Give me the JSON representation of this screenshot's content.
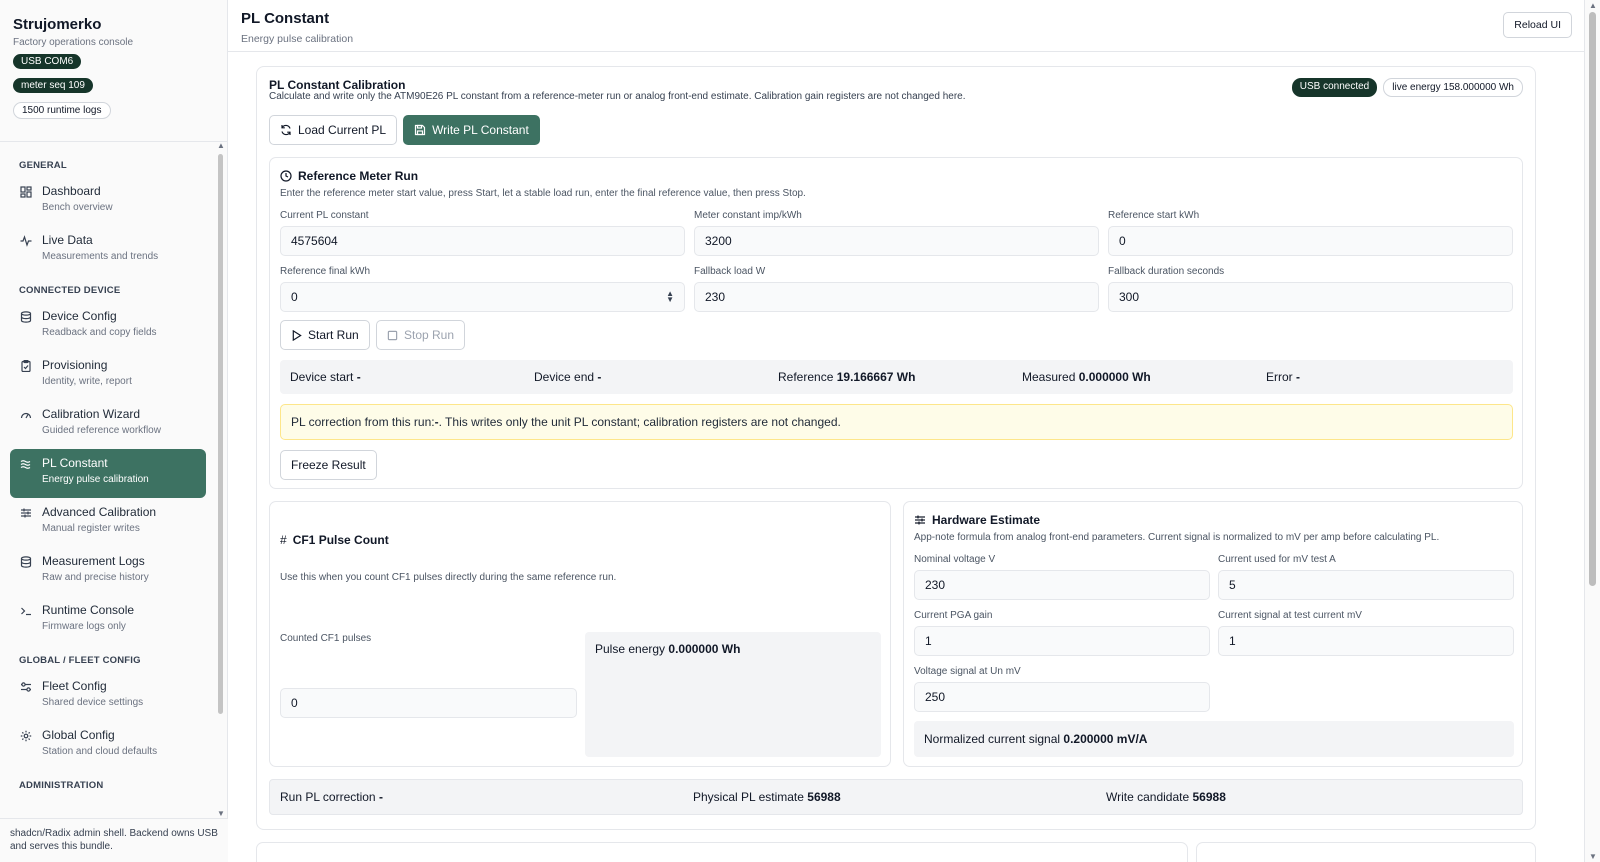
{
  "app": {
    "name": "Strujomerko",
    "subtitle": "Factory operations console",
    "pills": [
      "USB COM6",
      "meter seq 109",
      "1500 runtime logs"
    ],
    "footer": "shadcn/Radix admin shell. Backend owns USB and serves this bundle."
  },
  "sidebar": {
    "sections": [
      {
        "title": "GENERAL",
        "items": [
          {
            "label": "Dashboard",
            "sub": "Bench overview",
            "icon": "dashboard-icon"
          },
          {
            "label": "Live Data",
            "sub": "Measurements and trends",
            "icon": "activity-icon"
          }
        ]
      },
      {
        "title": "CONNECTED DEVICE",
        "items": [
          {
            "label": "Device Config",
            "sub": "Readback and copy fields",
            "icon": "database-icon"
          },
          {
            "label": "Provisioning",
            "sub": "Identity, write, report",
            "icon": "clipboard-icon"
          },
          {
            "label": "Calibration Wizard",
            "sub": "Guided reference workflow",
            "icon": "gauge-icon"
          },
          {
            "label": "PL Constant",
            "sub": "Energy pulse calibration",
            "icon": "waves-icon",
            "active": true
          },
          {
            "label": "Advanced Calibration",
            "sub": "Manual register writes",
            "icon": "sliders-icon"
          },
          {
            "label": "Measurement Logs",
            "sub": "Raw and precise history",
            "icon": "database-icon"
          },
          {
            "label": "Runtime Console",
            "sub": "Firmware logs only",
            "icon": "terminal-icon"
          }
        ]
      },
      {
        "title": "GLOBAL / FLEET CONFIG",
        "items": [
          {
            "label": "Fleet Config",
            "sub": "Shared device settings",
            "icon": "settings2-icon"
          },
          {
            "label": "Global Config",
            "sub": "Station and cloud defaults",
            "icon": "gear-icon"
          }
        ]
      },
      {
        "title": "ADMINISTRATION",
        "items": []
      }
    ]
  },
  "header": {
    "title": "PL Constant",
    "subtitle": "Energy pulse calibration",
    "reload_label": "Reload UI"
  },
  "calibration": {
    "title": "PL Constant Calibration",
    "description": "Calculate and write only the ATM90E26 PL constant from a reference-meter run or analog front-end estimate. Calibration gain registers are not changed here.",
    "status_usb": "USB connected",
    "status_energy": "live energy 158.000000 Wh",
    "load_label": "Load Current PL",
    "write_label": "Write PL Constant"
  },
  "reference_run": {
    "title": "Reference Meter Run",
    "description": "Enter the reference meter start value, press Start, let a stable load run, enter the final reference value, then press Stop.",
    "fields": {
      "current_pl": {
        "label": "Current PL constant",
        "value": "4575604"
      },
      "meter_constant": {
        "label": "Meter constant imp/kWh",
        "value": "3200"
      },
      "ref_start": {
        "label": "Reference start kWh",
        "value": "0"
      },
      "ref_final": {
        "label": "Reference final kWh",
        "value": "0"
      },
      "fallback_load": {
        "label": "Fallback load W",
        "value": "230"
      },
      "fallback_duration": {
        "label": "Fallback duration seconds",
        "value": "300"
      }
    },
    "start_label": "Start Run",
    "stop_label": "Stop Run",
    "summary": {
      "device_start_label": "Device start",
      "device_start": "-",
      "device_end_label": "Device end",
      "device_end": "-",
      "reference_label": "Reference",
      "reference": "19.166667 Wh",
      "measured_label": "Measured",
      "measured": "0.000000 Wh",
      "error_label": "Error",
      "error": "-"
    },
    "notice_prefix": "PL correction from this run: ",
    "notice_value": "-",
    "notice_suffix": ". This writes only the unit PL constant; calibration registers are not changed.",
    "freeze_label": "Freeze Result"
  },
  "cf1": {
    "title": "CF1 Pulse Count",
    "description": "Use this when you count CF1 pulses directly during the same reference run.",
    "counted_label": "Counted CF1 pulses",
    "counted_value": "0",
    "pulse_energy_label": "Pulse energy",
    "pulse_energy_value": "0.000000 Wh"
  },
  "hardware": {
    "title": "Hardware Estimate",
    "description": "App-note formula from analog front-end parameters. Current signal is normalized to mV per amp before calculating PL.",
    "fields": {
      "nominal_voltage": {
        "label": "Nominal voltage V",
        "value": "230"
      },
      "current_test": {
        "label": "Current used for mV test A",
        "value": "5"
      },
      "pga_gain": {
        "label": "Current PGA gain",
        "value": "1"
      },
      "current_signal": {
        "label": "Current signal at test current mV",
        "value": "1"
      },
      "voltage_signal": {
        "label": "Voltage signal at Un mV",
        "value": "250"
      }
    },
    "normalized_label": "Normalized current signal",
    "normalized_value": "0.200000 mV/A"
  },
  "results": {
    "run_pl_label": "Run PL correction",
    "run_pl": "-",
    "physical_label": "Physical PL estimate",
    "physical": "56988",
    "candidate_label": "Write candidate",
    "candidate": "56988"
  }
}
